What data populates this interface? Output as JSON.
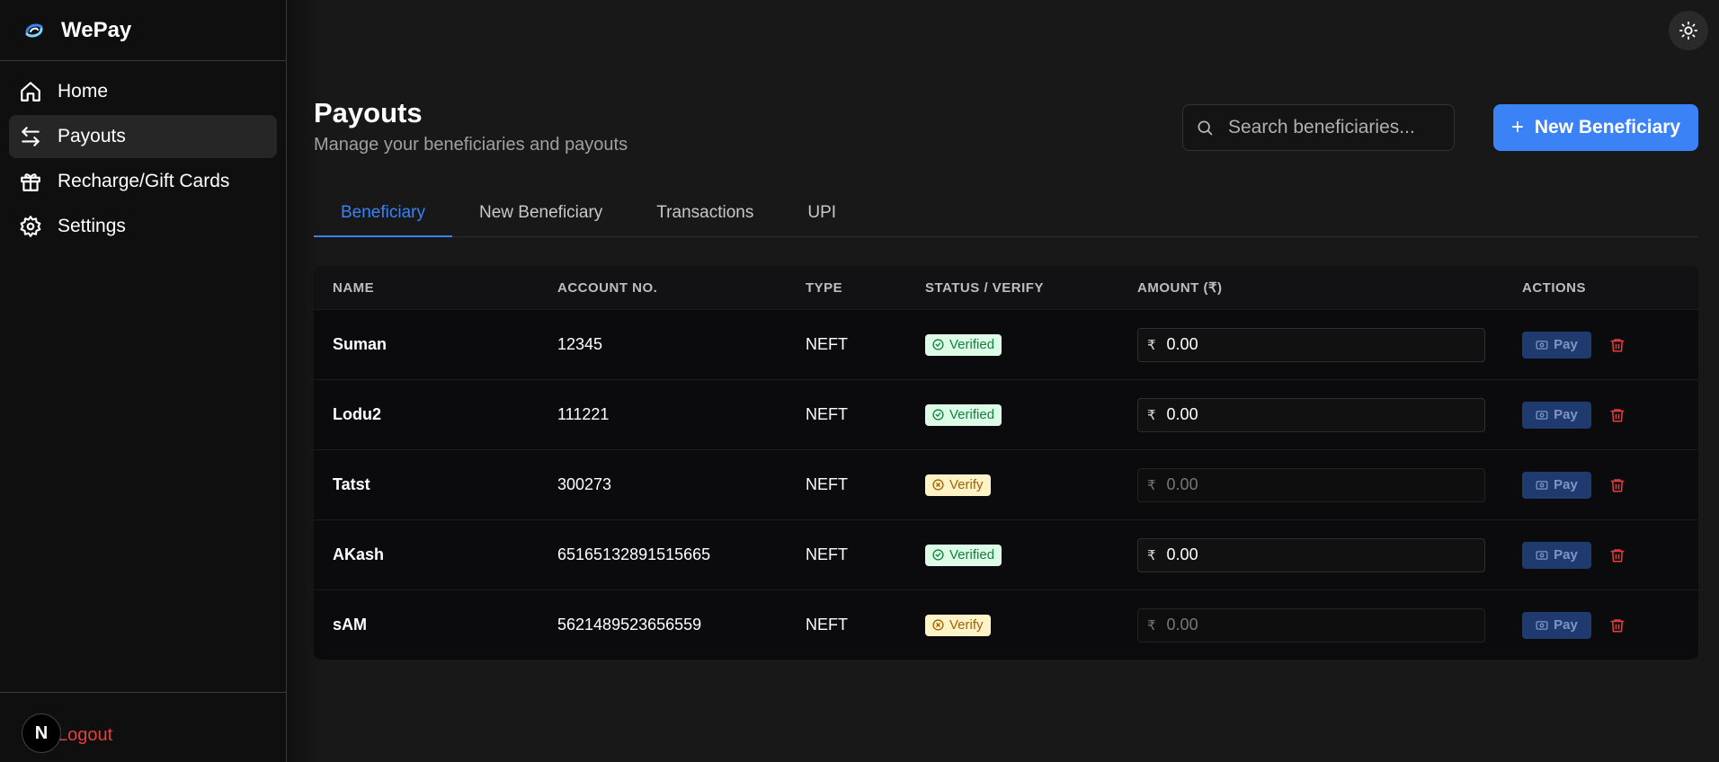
{
  "app": {
    "name": "WePay"
  },
  "sidebar": {
    "items": [
      {
        "label": "Home",
        "icon": "home-icon",
        "active": false
      },
      {
        "label": "Payouts",
        "icon": "arrows-swap-icon",
        "active": true
      },
      {
        "label": "Recharge/Gift Cards",
        "icon": "gift-icon",
        "active": false
      },
      {
        "label": "Settings",
        "icon": "gear-icon",
        "active": false
      }
    ],
    "logout_label": "Logout",
    "avatar_letter": "N"
  },
  "header": {
    "title": "Payouts",
    "subtitle": "Manage your beneficiaries and payouts",
    "search_placeholder": "Search beneficiaries...",
    "new_button_label": "New Beneficiary"
  },
  "tabs": [
    {
      "label": "Beneficiary",
      "active": true
    },
    {
      "label": "New Beneficiary",
      "active": false
    },
    {
      "label": "Transactions",
      "active": false
    },
    {
      "label": "UPI",
      "active": false
    }
  ],
  "table": {
    "columns": [
      "NAME",
      "ACCOUNT NO.",
      "TYPE",
      "STATUS / VERIFY",
      "AMOUNT (₹)",
      "ACTIONS"
    ],
    "rows": [
      {
        "name": "Suman",
        "account": "12345",
        "type": "NEFT",
        "status": "Verified",
        "verified": true,
        "amount": "0.00",
        "pay_label": "Pay"
      },
      {
        "name": "Lodu2",
        "account": "111221",
        "type": "NEFT",
        "status": "Verified",
        "verified": true,
        "amount": "0.00",
        "pay_label": "Pay"
      },
      {
        "name": "Tatst",
        "account": "300273",
        "type": "NEFT",
        "status": "Verify",
        "verified": false,
        "amount": "0.00",
        "pay_label": "Pay"
      },
      {
        "name": "AKash",
        "account": "65165132891515665",
        "type": "NEFT",
        "status": "Verified",
        "verified": true,
        "amount": "0.00",
        "pay_label": "Pay"
      },
      {
        "name": "sAM",
        "account": "5621489523656559",
        "type": "NEFT",
        "status": "Verify",
        "verified": false,
        "amount": "0.00",
        "pay_label": "Pay"
      }
    ],
    "currency_symbol": "₹"
  },
  "colors": {
    "accent": "#3b82f6",
    "verified_bg": "#dcfce7",
    "verify_bg": "#fef3c7",
    "danger": "#e53e3e"
  }
}
